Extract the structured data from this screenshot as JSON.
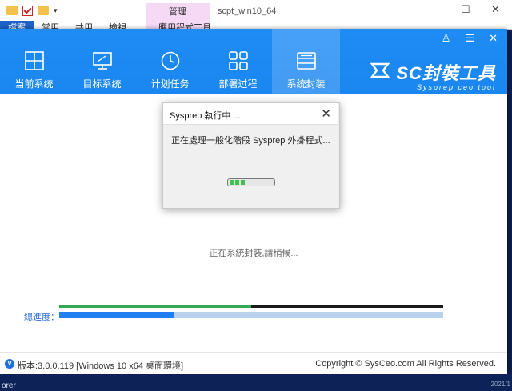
{
  "explorer": {
    "manage_tab": "管理",
    "window_title": "scpt_win10_64",
    "ribbon_tabs": [
      "檔案",
      "常用",
      "共用",
      "檢視",
      "應用程式工具"
    ],
    "minimize": "—",
    "maximize": "☐",
    "close": "✕"
  },
  "app": {
    "header_buttons": {
      "user": "♙",
      "menu": "☰",
      "close": "✕"
    },
    "nav": [
      {
        "label": "当前系统",
        "icon": "windows-icon"
      },
      {
        "label": "目标系统",
        "icon": "monitor-icon"
      },
      {
        "label": "计划任务",
        "icon": "clock-icon"
      },
      {
        "label": "部署过程",
        "icon": "grid-icon"
      },
      {
        "label": "系统封装",
        "icon": "package-icon",
        "active": true
      }
    ],
    "brand": {
      "name": "SC封裝工具",
      "tagline": "Sysprep ceo tool"
    },
    "status_text": "正在系統封裝,請稍候...",
    "progress": {
      "label": "總進度：",
      "step_fraction": 0.5,
      "total_fraction": 0.3
    },
    "footer": {
      "version_badge": "V",
      "version": "版本:3.0.0.119 [Windows 10 x64 桌面環境]",
      "copyright": "Copyright © SysCeo.com All Rights Reserved."
    }
  },
  "dialog": {
    "title": "Sysprep 執行中 ...",
    "close": "✕",
    "message": "正在處理一般化階段 Sysprep 外掛程式...",
    "progress_segments": 3
  },
  "taskbar": {
    "text": "orer",
    "clock": "2021/1"
  },
  "colors": {
    "header_blue": "#1f8cf5",
    "progress_green": "#34a853",
    "progress_blue": "#1f7ff0",
    "manage_pink": "#f5d9f5"
  }
}
